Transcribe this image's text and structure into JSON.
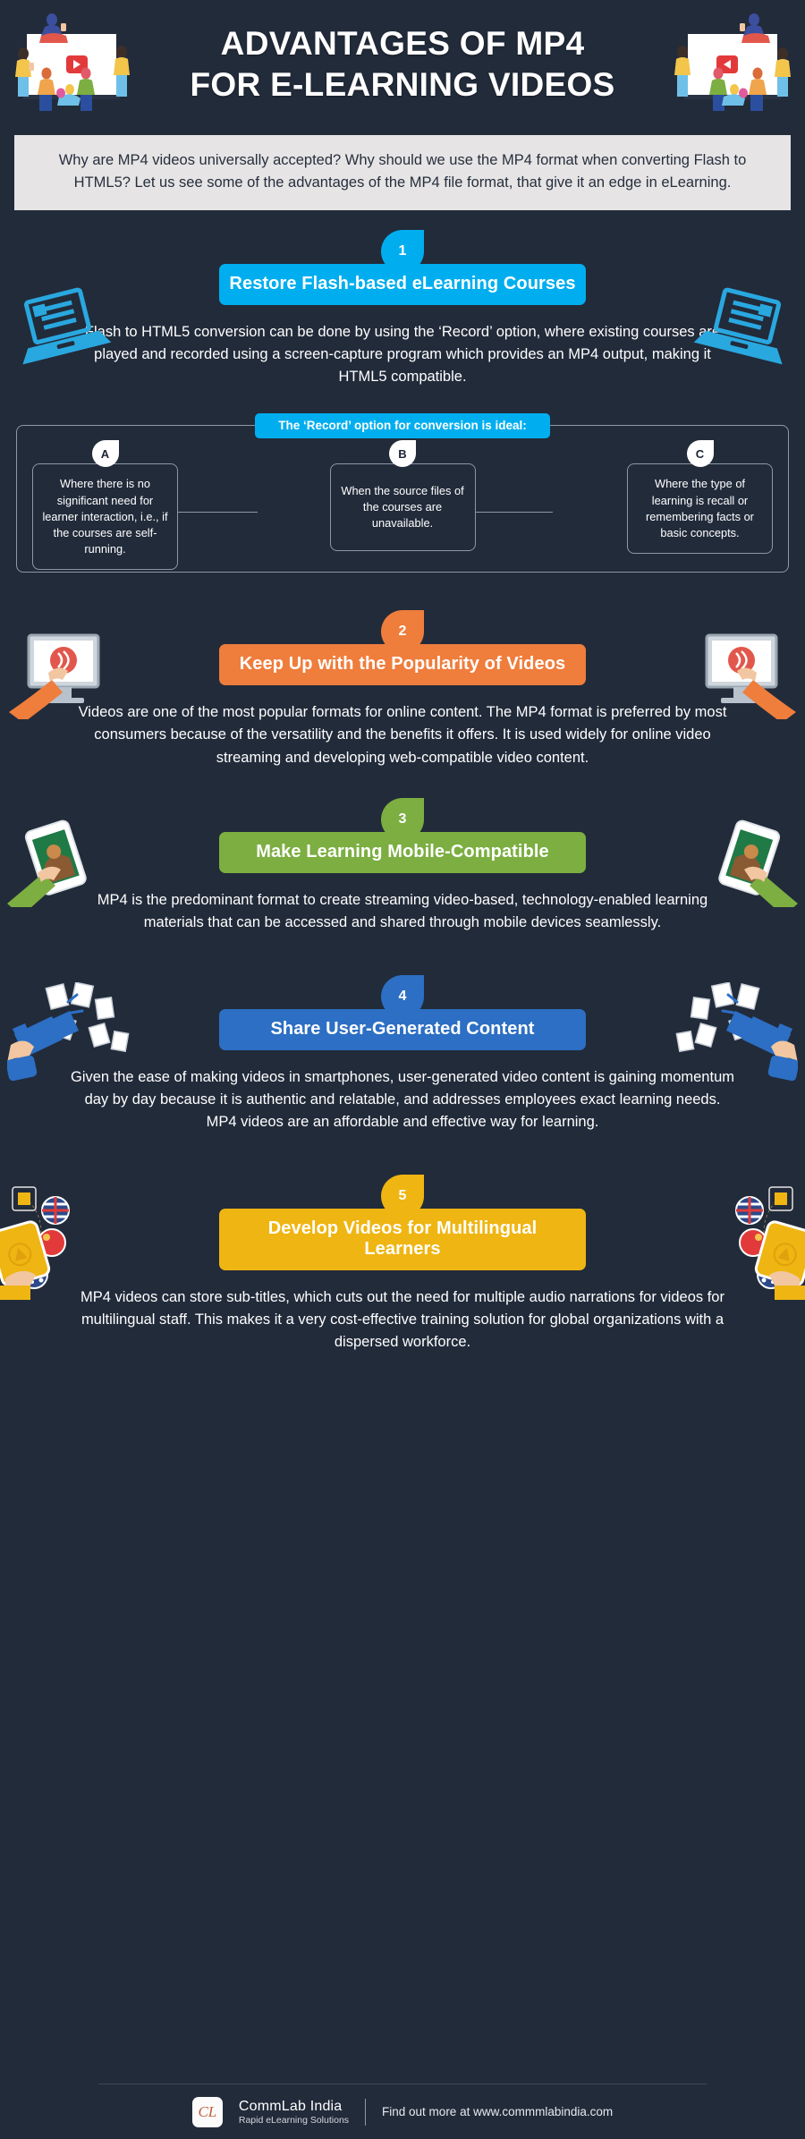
{
  "header": {
    "title_line1": "ADVANTAGES OF MP4",
    "title_line2": "FOR E-LEARNING VIDEOS",
    "art_left": "elearning-people-screen-illustration",
    "art_right": "elearning-people-screen-illustration"
  },
  "intro": {
    "text": "Why are MP4 videos universally accepted? Why should we use the MP4 format when converting Flash to HTML5?  Let us see some of the advantages of the MP4 file format, that give it an edge in eLearning."
  },
  "colors": {
    "background": "#222b3a",
    "intro_bg": "#e6e4e5",
    "accent_1": "#00aeef",
    "accent_2": "#ef7d3c",
    "accent_3": "#7cae41",
    "accent_4": "#2c6fc4",
    "accent_5": "#efb512",
    "text_light": "#ffffff",
    "border": "#8f97a3"
  },
  "sections": [
    {
      "number": "1",
      "title": "Restore Flash-based eLearning Courses",
      "body": "Flash to HTML5 conversion can be done by using the ‘Record’ option, where existing courses are played and recorded using a screen-capture program which provides an MP4 output, making it HTML5 compatible.",
      "color": "#00aeef",
      "art_left": "laptop-document-icon",
      "art_right": "laptop-document-icon"
    },
    {
      "number": "2",
      "title": "Keep Up with the Popularity of Videos",
      "body": "Videos are one of the most popular formats for online content. The MP4 format is preferred by most consumers because of the versatility and the benefits it offers. It is used widely for online video streaming and developing web-compatible video content.",
      "color": "#ef7d3c",
      "art_left": "hand-monitor-video-icon",
      "art_right": "hand-monitor-video-icon"
    },
    {
      "number": "3",
      "title": "Make Learning Mobile-Compatible",
      "body": "MP4 is the predominant format to create streaming video-based, technology-enabled learning materials that can be accessed and shared through mobile devices seamlessly.",
      "color": "#7cae41",
      "art_left": "hand-smartphone-video-icon",
      "art_right": "hand-smartphone-video-icon"
    },
    {
      "number": "4",
      "title": "Share User-Generated Content",
      "body": "Given the ease of making videos in smartphones, user-generated video content is gaining momentum day by day because it is authentic and relatable, and addresses employees exact learning needs. MP4 videos are an affordable and effective way for learning.",
      "color": "#2c6fc4",
      "art_left": "megaphone-papers-icon",
      "art_right": "megaphone-papers-icon"
    },
    {
      "number": "5",
      "title": "Develop Videos for Multilingual Learners",
      "body": "MP4 videos can store sub-titles, which cuts out the need for multiple audio narrations for videos for multilingual staff. This makes it a very cost-effective training solution for global organizations with a dispersed workforce.",
      "color": "#efb512",
      "art_left": "hand-tablet-flags-icon",
      "art_right": "hand-tablet-flags-icon"
    }
  ],
  "flowchart": {
    "header": "The ‘Record’ option for conversion is ideal:",
    "cards": [
      {
        "letter": "A",
        "text": "Where there is no significant need for learner interaction, i.e., if the courses are self-running."
      },
      {
        "letter": "B",
        "text": "When the source files of the courses are unavailable."
      },
      {
        "letter": "C",
        "text": "Where the type of learning is recall or remembering facts or basic concepts."
      }
    ]
  },
  "footer": {
    "logo_initials": "CL",
    "brand_name": "CommLab India",
    "brand_tagline": "Rapid eLearning Solutions",
    "url_text": "Find out more at www.commmlabindia.com"
  }
}
